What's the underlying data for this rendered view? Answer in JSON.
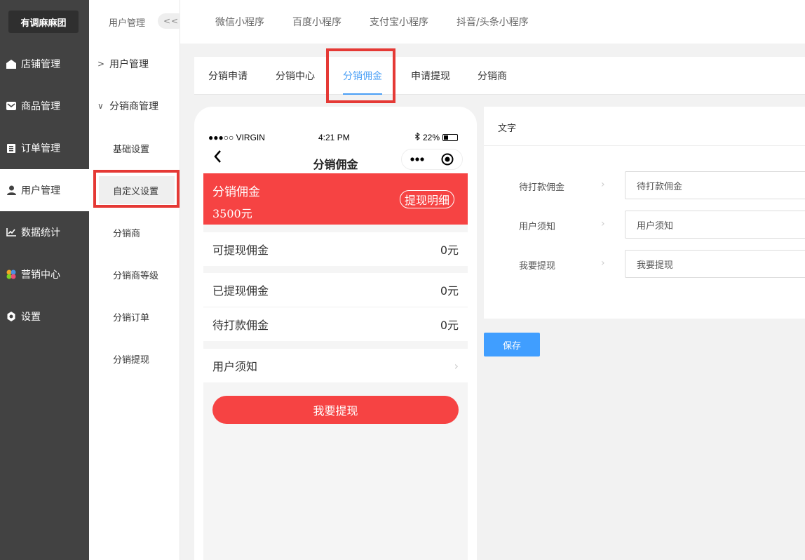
{
  "sidebar": {
    "brand": "有调麻麻团",
    "items": [
      {
        "label": "店铺管理",
        "icon": "home-icon"
      },
      {
        "label": "商品管理",
        "icon": "mail-icon"
      },
      {
        "label": "订单管理",
        "icon": "clipboard-icon"
      },
      {
        "label": "用户管理",
        "icon": "user-icon",
        "active": true
      },
      {
        "label": "数据统计",
        "icon": "chart-icon"
      },
      {
        "label": "营销中心",
        "icon": "marketing-icon"
      },
      {
        "label": "设置",
        "icon": "gear-icon"
      }
    ]
  },
  "submenu": {
    "title": "用户管理",
    "collapse": "<<",
    "items": [
      {
        "label": "用户管理",
        "type": "group",
        "chevron": ">"
      },
      {
        "label": "分销商管理",
        "type": "group",
        "chevron": "∨"
      },
      {
        "label": "基础设置",
        "type": "leaf"
      },
      {
        "label": "自定义设置",
        "type": "leaf",
        "selected": true
      },
      {
        "label": "分销商",
        "type": "leaf"
      },
      {
        "label": "分销商等级",
        "type": "leaf"
      },
      {
        "label": "分销订单",
        "type": "leaf"
      },
      {
        "label": "分销提现",
        "type": "leaf"
      }
    ]
  },
  "topbar": {
    "tabs": [
      "微信小程序",
      "百度小程序",
      "支付宝小程序",
      "抖音/头条小程序"
    ]
  },
  "subtabs": {
    "tabs": [
      "分销申请",
      "分销中心",
      "分销佣金",
      "申请提现",
      "分销商"
    ],
    "active": "分销佣金"
  },
  "phone": {
    "status": {
      "carrier": "●●●○○ VIRGIN",
      "time": "4:21 PM",
      "battery": "22%",
      "battery_level": 0.22
    },
    "nav_title": "分销佣金",
    "banner": {
      "label": "分销佣金",
      "amount": "3500元",
      "detail": "提现明细"
    },
    "rows": [
      {
        "label": "可提现佣金",
        "value": "0元"
      },
      {
        "label": "已提现佣金",
        "value": "0元"
      },
      {
        "label": "待打款佣金",
        "value": "0元"
      },
      {
        "label": "用户须知",
        "value": "›"
      }
    ],
    "cta": "我要提现"
  },
  "panel": {
    "header": "文字",
    "fields": [
      {
        "label": "待打款佣金",
        "value": "待打款佣金"
      },
      {
        "label": "用户须知",
        "value": "用户须知"
      },
      {
        "label": "我要提现",
        "value": "我要提现"
      }
    ],
    "save": "保存"
  },
  "colors": {
    "sidebar_bg": "#424242",
    "accent_blue": "#409eff",
    "tab_active": "#4a9ff5",
    "banner_red": "#f64343",
    "highlight_red": "#e53935"
  }
}
